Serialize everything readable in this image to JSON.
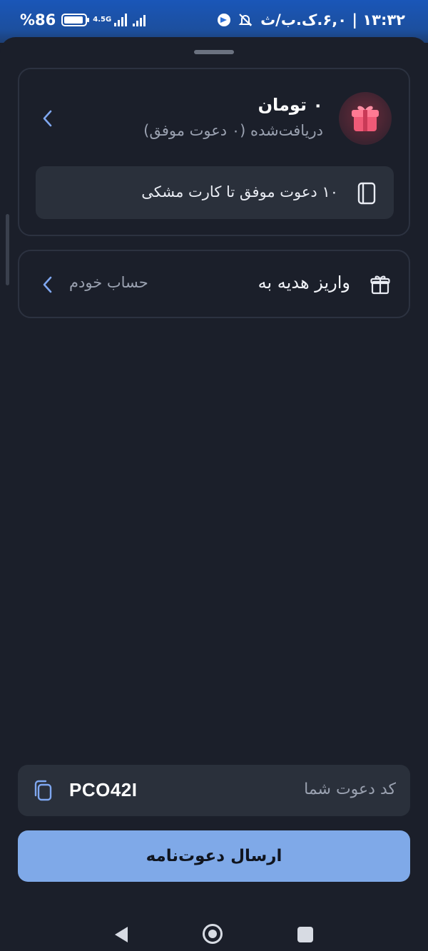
{
  "status_bar": {
    "time_date": "۱۳:۳۲ | ۶,۰.ک.ب/ث",
    "battery": "%86",
    "network": "4.5G",
    "telegram_icon": "telegram-icon",
    "mute_icon": "bell-off-icon"
  },
  "reward_card": {
    "amount": "۰ تومان",
    "subtitle": "دریافت‌شده (۰ دعوت موفق)",
    "progress_text": "۱۰ دعوت موفق تا کارت مشکی",
    "icon": "gift-icon"
  },
  "deposit": {
    "title": "واریز هدیه به",
    "value": "حساب خودم"
  },
  "invite": {
    "label": "کد دعوت شما",
    "code": "PCO42I"
  },
  "actions": {
    "send_label": "ارسال دعوت‌نامه"
  },
  "colors": {
    "background": "#1b1f2a",
    "surface": "#2a303b",
    "accent": "#7fa9e8",
    "status_bar": "#1c4f9e"
  }
}
